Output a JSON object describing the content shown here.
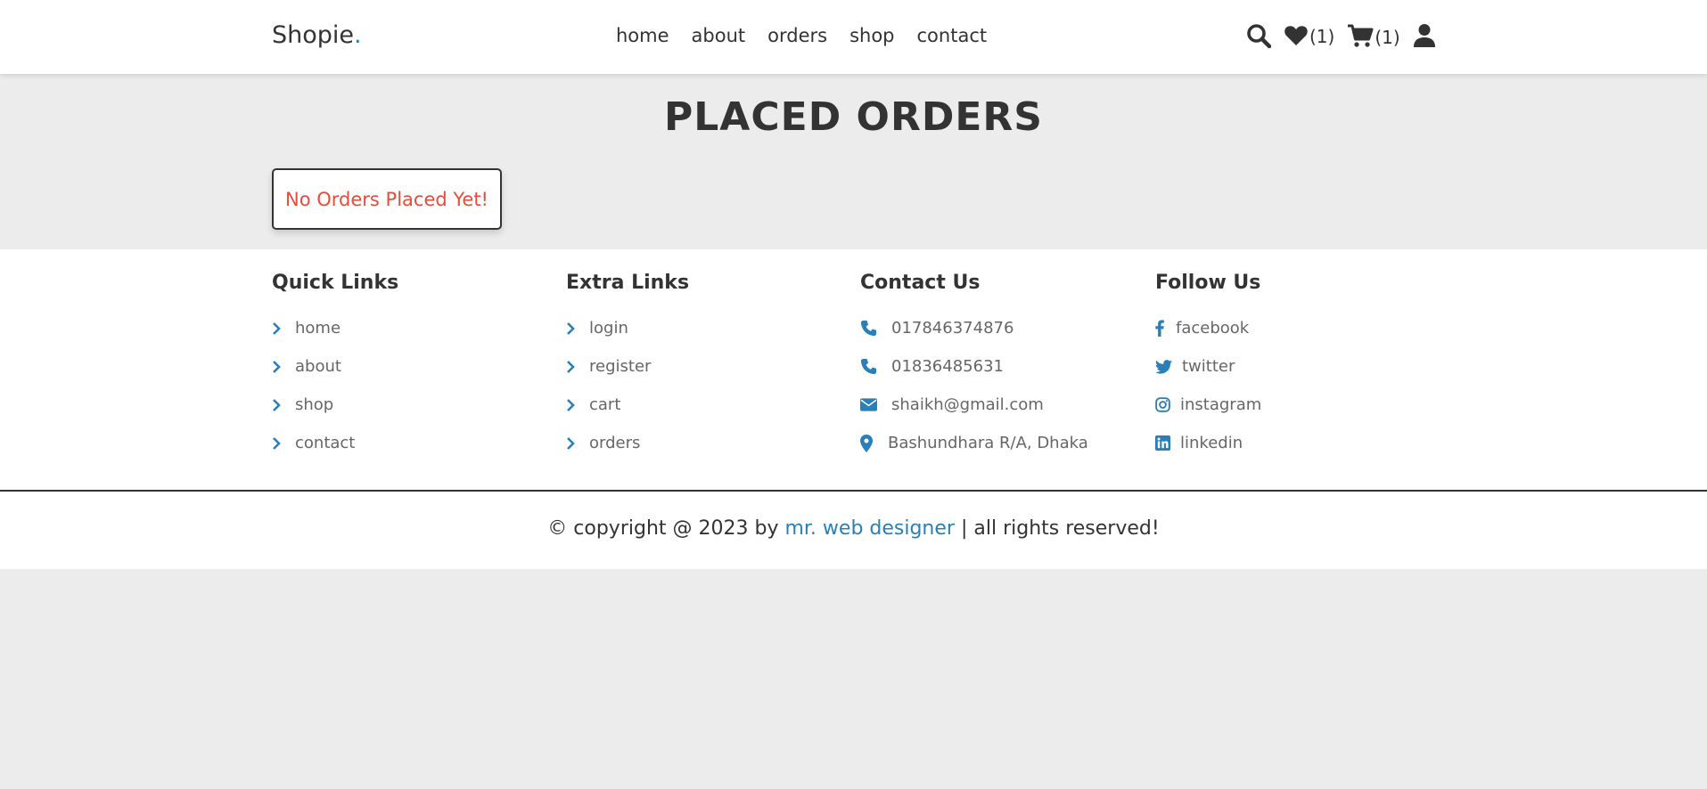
{
  "header": {
    "logo": "Shopie",
    "logo_dot": ".",
    "nav": [
      "home",
      "about",
      "orders",
      "shop",
      "contact"
    ],
    "wishlist_count": "(1)",
    "cart_count": "(1)",
    "icons": [
      "search-icon",
      "heart-icon",
      "cart-icon",
      "user-icon"
    ]
  },
  "main": {
    "title": "PLACED ORDERS",
    "empty_message": "No Orders Placed Yet!"
  },
  "footer": {
    "quick_links": {
      "title": "Quick Links",
      "items": [
        "home",
        "about",
        "shop",
        "contact"
      ]
    },
    "extra_links": {
      "title": "Extra Links",
      "items": [
        "login",
        "register",
        "cart",
        "orders"
      ]
    },
    "contact": {
      "title": "Contact Us",
      "items": [
        "017846374876",
        "01836485631",
        "shaikh@gmail.com",
        "Bashundhara R/A, Dhaka"
      ]
    },
    "follow": {
      "title": "Follow Us",
      "items": [
        "facebook",
        "twitter",
        "instagram",
        "linkedin"
      ]
    },
    "credit_prefix": "© copyright @ 2023 by ",
    "credit_name": "mr. web designer",
    "credit_suffix": " | all rights reserved!"
  },
  "colors": {
    "accent": "#2980b9",
    "error": "#e74c3c",
    "text": "#333333",
    "background": "#ececec"
  }
}
